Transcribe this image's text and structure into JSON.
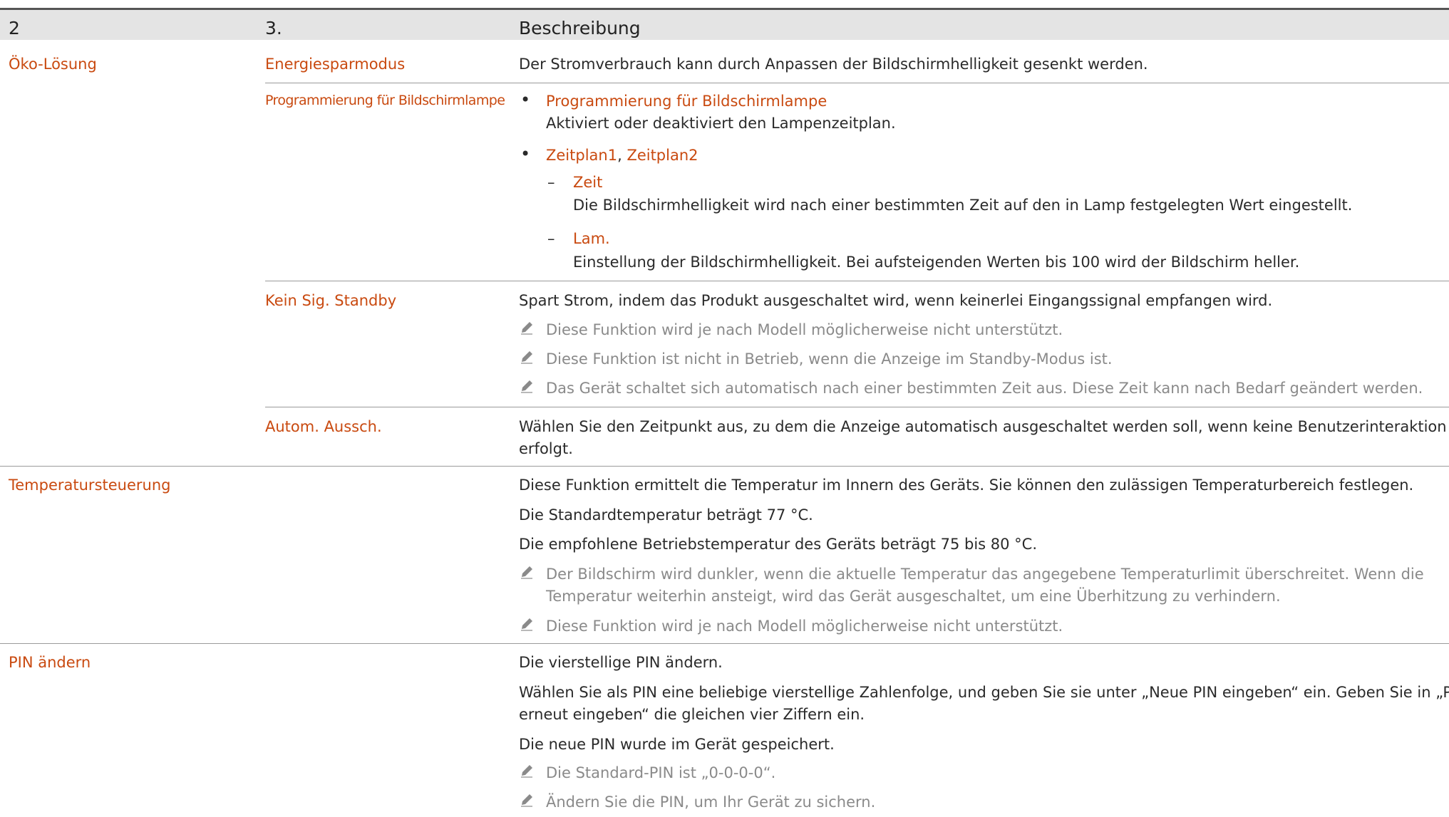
{
  "header": {
    "col1": "2",
    "col2": "3.",
    "col3": "Beschreibung"
  },
  "rows": {
    "oeko": {
      "category": "Öko-Lösung",
      "energie": {
        "label": "Energiesparmodus",
        "desc": "Der Stromverbrauch kann durch Anpassen der Bildschirmhelligkeit gesenkt werden."
      },
      "lampe": {
        "label": "Programmierung für Bildschirmlampe",
        "bullet1_title": "Programmierung für Bildschirmlampe",
        "bullet1_desc": "Aktiviert oder deaktiviert den Lampenzeitplan.",
        "bullet2_a": "Zeitplan1",
        "bullet2_sep": ", ",
        "bullet2_b": "Zeitplan2",
        "dash": "–",
        "zeit_title": "Zeit",
        "zeit_desc": "Die Bildschirmhelligkeit wird nach einer bestimmten Zeit auf den in Lamp festgelegten Wert eingestellt.",
        "lam_title": "Lam.",
        "lam_desc": "Einstellung der Bildschirmhelligkeit. Bei aufsteigenden Werten bis 100 wird der Bildschirm heller.",
        "bullet_char": "•"
      },
      "standby": {
        "label": "Kein Sig. Standby",
        "desc": "Spart Strom, indem das Produkt ausgeschaltet wird, wenn keinerlei Eingangssignal empfangen wird.",
        "note1": "Diese Funktion wird je nach Modell möglicherweise nicht unterstützt.",
        "note2": "Diese Funktion ist nicht in Betrieb, wenn die Anzeige im Standby-Modus ist.",
        "note3": "Das Gerät schaltet sich automatisch nach einer bestimmten Zeit aus. Diese Zeit kann nach Bedarf geändert werden."
      },
      "aus": {
        "label": "Autom. Aussch.",
        "desc1": "Wählen Sie den Zeitpunkt aus, zu dem die Anzeige automatisch ausgeschaltet werden soll, wenn keine Benutzerinteraktion",
        "desc2": "erfolgt."
      }
    },
    "temp": {
      "category": "Temperatursteuerung",
      "desc1": "Diese Funktion ermittelt die Temperatur im Innern des Geräts. Sie können den zulässigen Temperaturbereich festlegen.",
      "desc2": "Die Standardtemperatur beträgt 77 °C.",
      "desc3": "Die empfohlene Betriebstemperatur des Geräts beträgt 75 bis 80 °C.",
      "note1a": "Der Bildschirm wird dunkler, wenn die aktuelle Temperatur das angegebene Temperaturlimit überschreitet. Wenn die",
      "note1b": "Temperatur weiterhin ansteigt, wird das Gerät ausgeschaltet, um eine Überhitzung zu verhindern.",
      "note2": "Diese Funktion wird je nach Modell möglicherweise nicht unterstützt."
    },
    "pin": {
      "category": "PIN ändern",
      "desc1": "Die vierstellige PIN ändern.",
      "desc2a": "Wählen Sie als PIN eine beliebige vierstellige Zahlenfolge, und geben Sie sie unter „Neue PIN eingeben“ ein. Geben Sie in „PIN",
      "desc2b": "erneut eingeben“ die gleichen vier Ziffern ein.",
      "desc3": "Die neue PIN wurde im Gerät gespeichert.",
      "note1": "Die Standard-PIN ist „0-0-0-0“.",
      "note2": "Ändern Sie die PIN, um Ihr Gerät zu sichern."
    }
  },
  "colors": {
    "accent": "#c94a10",
    "note": "#8a8a8a",
    "header_bg": "#e4e4e4"
  },
  "icons": {
    "note": "pencil-icon"
  }
}
